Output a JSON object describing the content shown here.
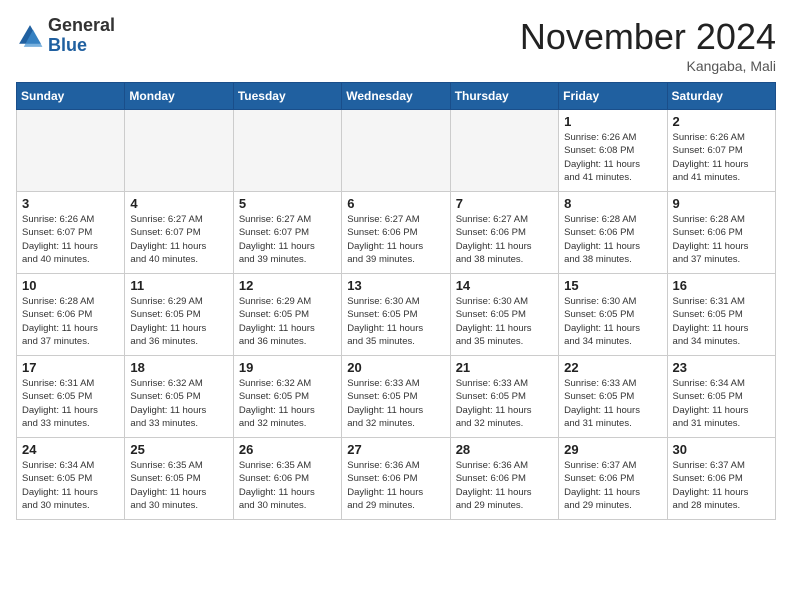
{
  "header": {
    "logo_general": "General",
    "logo_blue": "Blue",
    "month_title": "November 2024",
    "location": "Kangaba, Mali"
  },
  "weekdays": [
    "Sunday",
    "Monday",
    "Tuesday",
    "Wednesday",
    "Thursday",
    "Friday",
    "Saturday"
  ],
  "weeks": [
    [
      {
        "day": "",
        "info": ""
      },
      {
        "day": "",
        "info": ""
      },
      {
        "day": "",
        "info": ""
      },
      {
        "day": "",
        "info": ""
      },
      {
        "day": "",
        "info": ""
      },
      {
        "day": "1",
        "info": "Sunrise: 6:26 AM\nSunset: 6:08 PM\nDaylight: 11 hours\nand 41 minutes."
      },
      {
        "day": "2",
        "info": "Sunrise: 6:26 AM\nSunset: 6:07 PM\nDaylight: 11 hours\nand 41 minutes."
      }
    ],
    [
      {
        "day": "3",
        "info": "Sunrise: 6:26 AM\nSunset: 6:07 PM\nDaylight: 11 hours\nand 40 minutes."
      },
      {
        "day": "4",
        "info": "Sunrise: 6:27 AM\nSunset: 6:07 PM\nDaylight: 11 hours\nand 40 minutes."
      },
      {
        "day": "5",
        "info": "Sunrise: 6:27 AM\nSunset: 6:07 PM\nDaylight: 11 hours\nand 39 minutes."
      },
      {
        "day": "6",
        "info": "Sunrise: 6:27 AM\nSunset: 6:06 PM\nDaylight: 11 hours\nand 39 minutes."
      },
      {
        "day": "7",
        "info": "Sunrise: 6:27 AM\nSunset: 6:06 PM\nDaylight: 11 hours\nand 38 minutes."
      },
      {
        "day": "8",
        "info": "Sunrise: 6:28 AM\nSunset: 6:06 PM\nDaylight: 11 hours\nand 38 minutes."
      },
      {
        "day": "9",
        "info": "Sunrise: 6:28 AM\nSunset: 6:06 PM\nDaylight: 11 hours\nand 37 minutes."
      }
    ],
    [
      {
        "day": "10",
        "info": "Sunrise: 6:28 AM\nSunset: 6:06 PM\nDaylight: 11 hours\nand 37 minutes."
      },
      {
        "day": "11",
        "info": "Sunrise: 6:29 AM\nSunset: 6:05 PM\nDaylight: 11 hours\nand 36 minutes."
      },
      {
        "day": "12",
        "info": "Sunrise: 6:29 AM\nSunset: 6:05 PM\nDaylight: 11 hours\nand 36 minutes."
      },
      {
        "day": "13",
        "info": "Sunrise: 6:30 AM\nSunset: 6:05 PM\nDaylight: 11 hours\nand 35 minutes."
      },
      {
        "day": "14",
        "info": "Sunrise: 6:30 AM\nSunset: 6:05 PM\nDaylight: 11 hours\nand 35 minutes."
      },
      {
        "day": "15",
        "info": "Sunrise: 6:30 AM\nSunset: 6:05 PM\nDaylight: 11 hours\nand 34 minutes."
      },
      {
        "day": "16",
        "info": "Sunrise: 6:31 AM\nSunset: 6:05 PM\nDaylight: 11 hours\nand 34 minutes."
      }
    ],
    [
      {
        "day": "17",
        "info": "Sunrise: 6:31 AM\nSunset: 6:05 PM\nDaylight: 11 hours\nand 33 minutes."
      },
      {
        "day": "18",
        "info": "Sunrise: 6:32 AM\nSunset: 6:05 PM\nDaylight: 11 hours\nand 33 minutes."
      },
      {
        "day": "19",
        "info": "Sunrise: 6:32 AM\nSunset: 6:05 PM\nDaylight: 11 hours\nand 32 minutes."
      },
      {
        "day": "20",
        "info": "Sunrise: 6:33 AM\nSunset: 6:05 PM\nDaylight: 11 hours\nand 32 minutes."
      },
      {
        "day": "21",
        "info": "Sunrise: 6:33 AM\nSunset: 6:05 PM\nDaylight: 11 hours\nand 32 minutes."
      },
      {
        "day": "22",
        "info": "Sunrise: 6:33 AM\nSunset: 6:05 PM\nDaylight: 11 hours\nand 31 minutes."
      },
      {
        "day": "23",
        "info": "Sunrise: 6:34 AM\nSunset: 6:05 PM\nDaylight: 11 hours\nand 31 minutes."
      }
    ],
    [
      {
        "day": "24",
        "info": "Sunrise: 6:34 AM\nSunset: 6:05 PM\nDaylight: 11 hours\nand 30 minutes."
      },
      {
        "day": "25",
        "info": "Sunrise: 6:35 AM\nSunset: 6:05 PM\nDaylight: 11 hours\nand 30 minutes."
      },
      {
        "day": "26",
        "info": "Sunrise: 6:35 AM\nSunset: 6:06 PM\nDaylight: 11 hours\nand 30 minutes."
      },
      {
        "day": "27",
        "info": "Sunrise: 6:36 AM\nSunset: 6:06 PM\nDaylight: 11 hours\nand 29 minutes."
      },
      {
        "day": "28",
        "info": "Sunrise: 6:36 AM\nSunset: 6:06 PM\nDaylight: 11 hours\nand 29 minutes."
      },
      {
        "day": "29",
        "info": "Sunrise: 6:37 AM\nSunset: 6:06 PM\nDaylight: 11 hours\nand 29 minutes."
      },
      {
        "day": "30",
        "info": "Sunrise: 6:37 AM\nSunset: 6:06 PM\nDaylight: 11 hours\nand 28 minutes."
      }
    ]
  ]
}
